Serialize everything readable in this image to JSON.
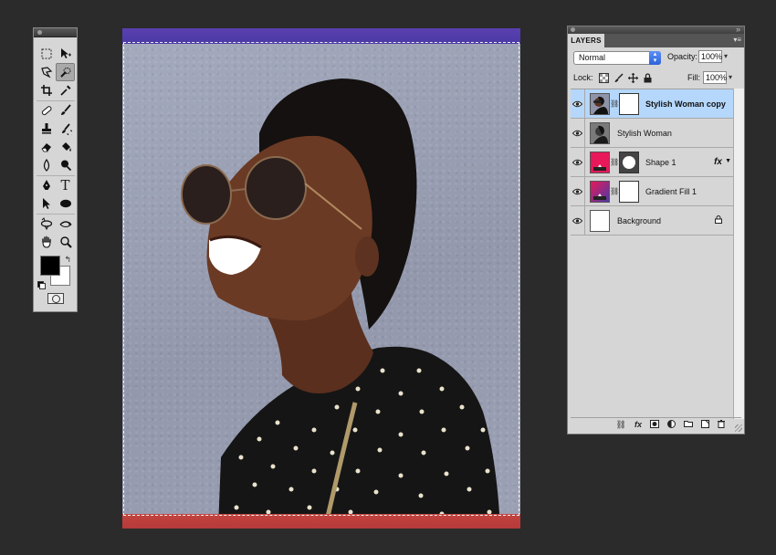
{
  "layers_panel": {
    "tab": "LAYERS",
    "blend_mode": "Normal",
    "opacity_label": "Opacity:",
    "opacity_value": "100%",
    "lock_label": "Lock:",
    "fill_label": "Fill:",
    "fill_value": "100%",
    "fx_label": "fx",
    "layers": [
      {
        "name": "Stylish Woman copy",
        "selected": true
      },
      {
        "name": "Stylish Woman",
        "selected": false
      },
      {
        "name": "Shape 1",
        "selected": false
      },
      {
        "name": "Gradient Fill 1",
        "selected": false
      },
      {
        "name": "Background",
        "selected": false
      }
    ],
    "footer_fx": "fx"
  },
  "tools": {
    "type_tool_glyph": "T"
  },
  "colors": {
    "foreground": "#000000",
    "background": "#ffffff",
    "top_band": "#4b3aa6",
    "bottom_band": "#b53a3a",
    "selection_highlight": "#b5d7fb",
    "shape_thumb": "#e8185a"
  }
}
